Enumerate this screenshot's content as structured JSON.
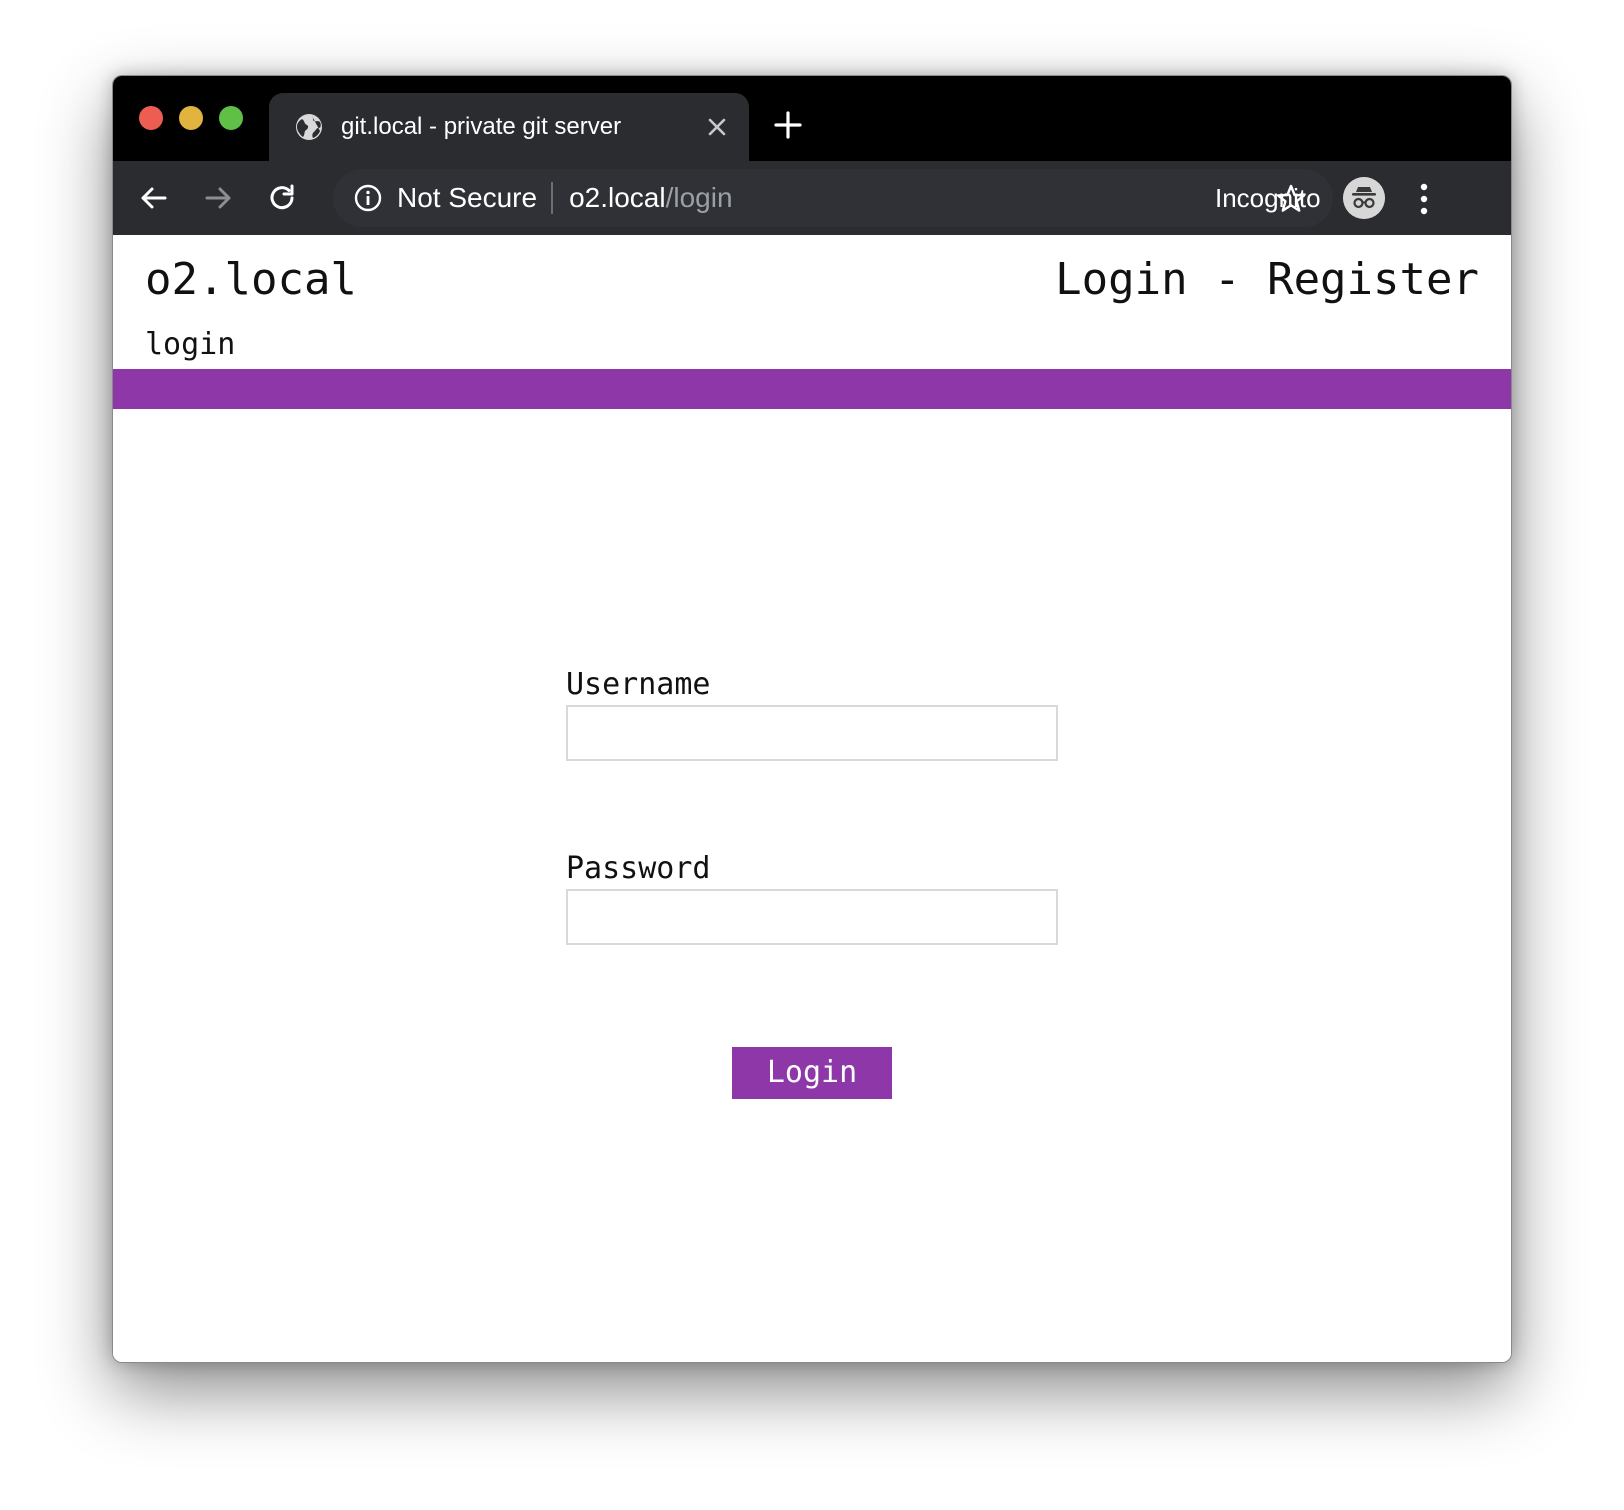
{
  "browser": {
    "tab": {
      "title": "git.local - private git server",
      "icon": "globe-icon",
      "close_icon": "close-icon"
    },
    "new_tab_icon": "plus-icon",
    "toolbar": {
      "back_icon": "back-arrow-icon",
      "forward_icon": "forward-arrow-icon",
      "reload_icon": "reload-icon",
      "security_label": "Not Secure",
      "url_host": "o2.local",
      "url_path": "/login",
      "bookmark_icon": "star-icon",
      "profile_label": "Incognito",
      "profile_icon": "incognito-icon",
      "menu_icon": "kebab-menu-icon"
    }
  },
  "page": {
    "site_title": "o2.local",
    "nav": {
      "login": "Login",
      "separator": "-",
      "register": "Register"
    },
    "breadcrumb": "login",
    "accent_color": "#8e37a9",
    "form": {
      "username_label": "Username",
      "username_value": "",
      "password_label": "Password",
      "password_value": "",
      "submit_label": "Login"
    }
  }
}
